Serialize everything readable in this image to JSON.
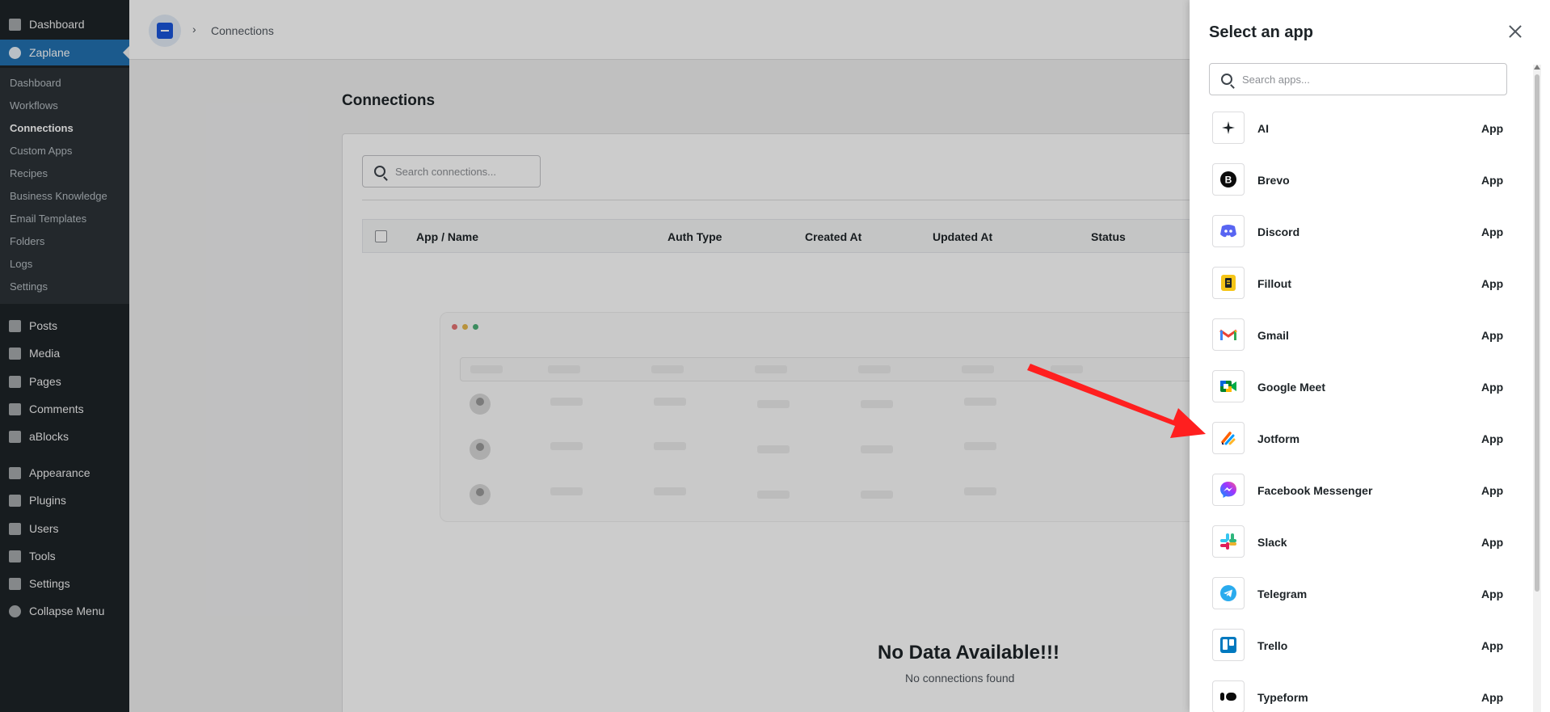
{
  "wp_menu": {
    "dashboard": "Dashboard",
    "zaplane": "Zaplane",
    "submenu": [
      "Dashboard",
      "Workflows",
      "Connections",
      "Custom Apps",
      "Recipes",
      "Business Knowledge",
      "Email Templates",
      "Folders",
      "Logs",
      "Settings"
    ],
    "posts": "Posts",
    "media": "Media",
    "pages": "Pages",
    "comments": "Comments",
    "ablocks": "aBlocks",
    "appearance": "Appearance",
    "plugins": "Plugins",
    "users": "Users",
    "tools": "Tools",
    "settings": "Settings",
    "collapse": "Collapse Menu"
  },
  "breadcrumb": {
    "chevron": "›",
    "current": "Connections"
  },
  "page": {
    "title": "Connections",
    "search_placeholder": "Search connections...",
    "columns": [
      "App / Name",
      "Auth Type",
      "Created At",
      "Updated At",
      "Status"
    ],
    "empty_title": "No Data Available!!!",
    "empty_subtitle": "No connections found"
  },
  "drawer": {
    "title": "Select an app",
    "search_placeholder": "Search apps...",
    "apps": [
      {
        "name": "AI",
        "kind": "App",
        "icon": "sparkle-icon"
      },
      {
        "name": "Brevo",
        "kind": "App",
        "icon": "brevo-icon"
      },
      {
        "name": "Discord",
        "kind": "App",
        "icon": "discord-icon"
      },
      {
        "name": "Fillout",
        "kind": "App",
        "icon": "fillout-icon"
      },
      {
        "name": "Gmail",
        "kind": "App",
        "icon": "gmail-icon"
      },
      {
        "name": "Google Meet",
        "kind": "App",
        "icon": "google-meet-icon"
      },
      {
        "name": "Jotform",
        "kind": "App",
        "icon": "jotform-icon"
      },
      {
        "name": "Facebook Messenger",
        "kind": "App",
        "icon": "messenger-icon"
      },
      {
        "name": "Slack",
        "kind": "App",
        "icon": "slack-icon"
      },
      {
        "name": "Telegram",
        "kind": "App",
        "icon": "telegram-icon"
      },
      {
        "name": "Trello",
        "kind": "App",
        "icon": "trello-icon"
      },
      {
        "name": "Typeform",
        "kind": "App",
        "icon": "typeform-icon"
      }
    ]
  },
  "colors": {
    "wp_sidebar": "#1d2327",
    "wp_accent": "#2271b1",
    "annotation_arrow": "#ff1f1f"
  }
}
